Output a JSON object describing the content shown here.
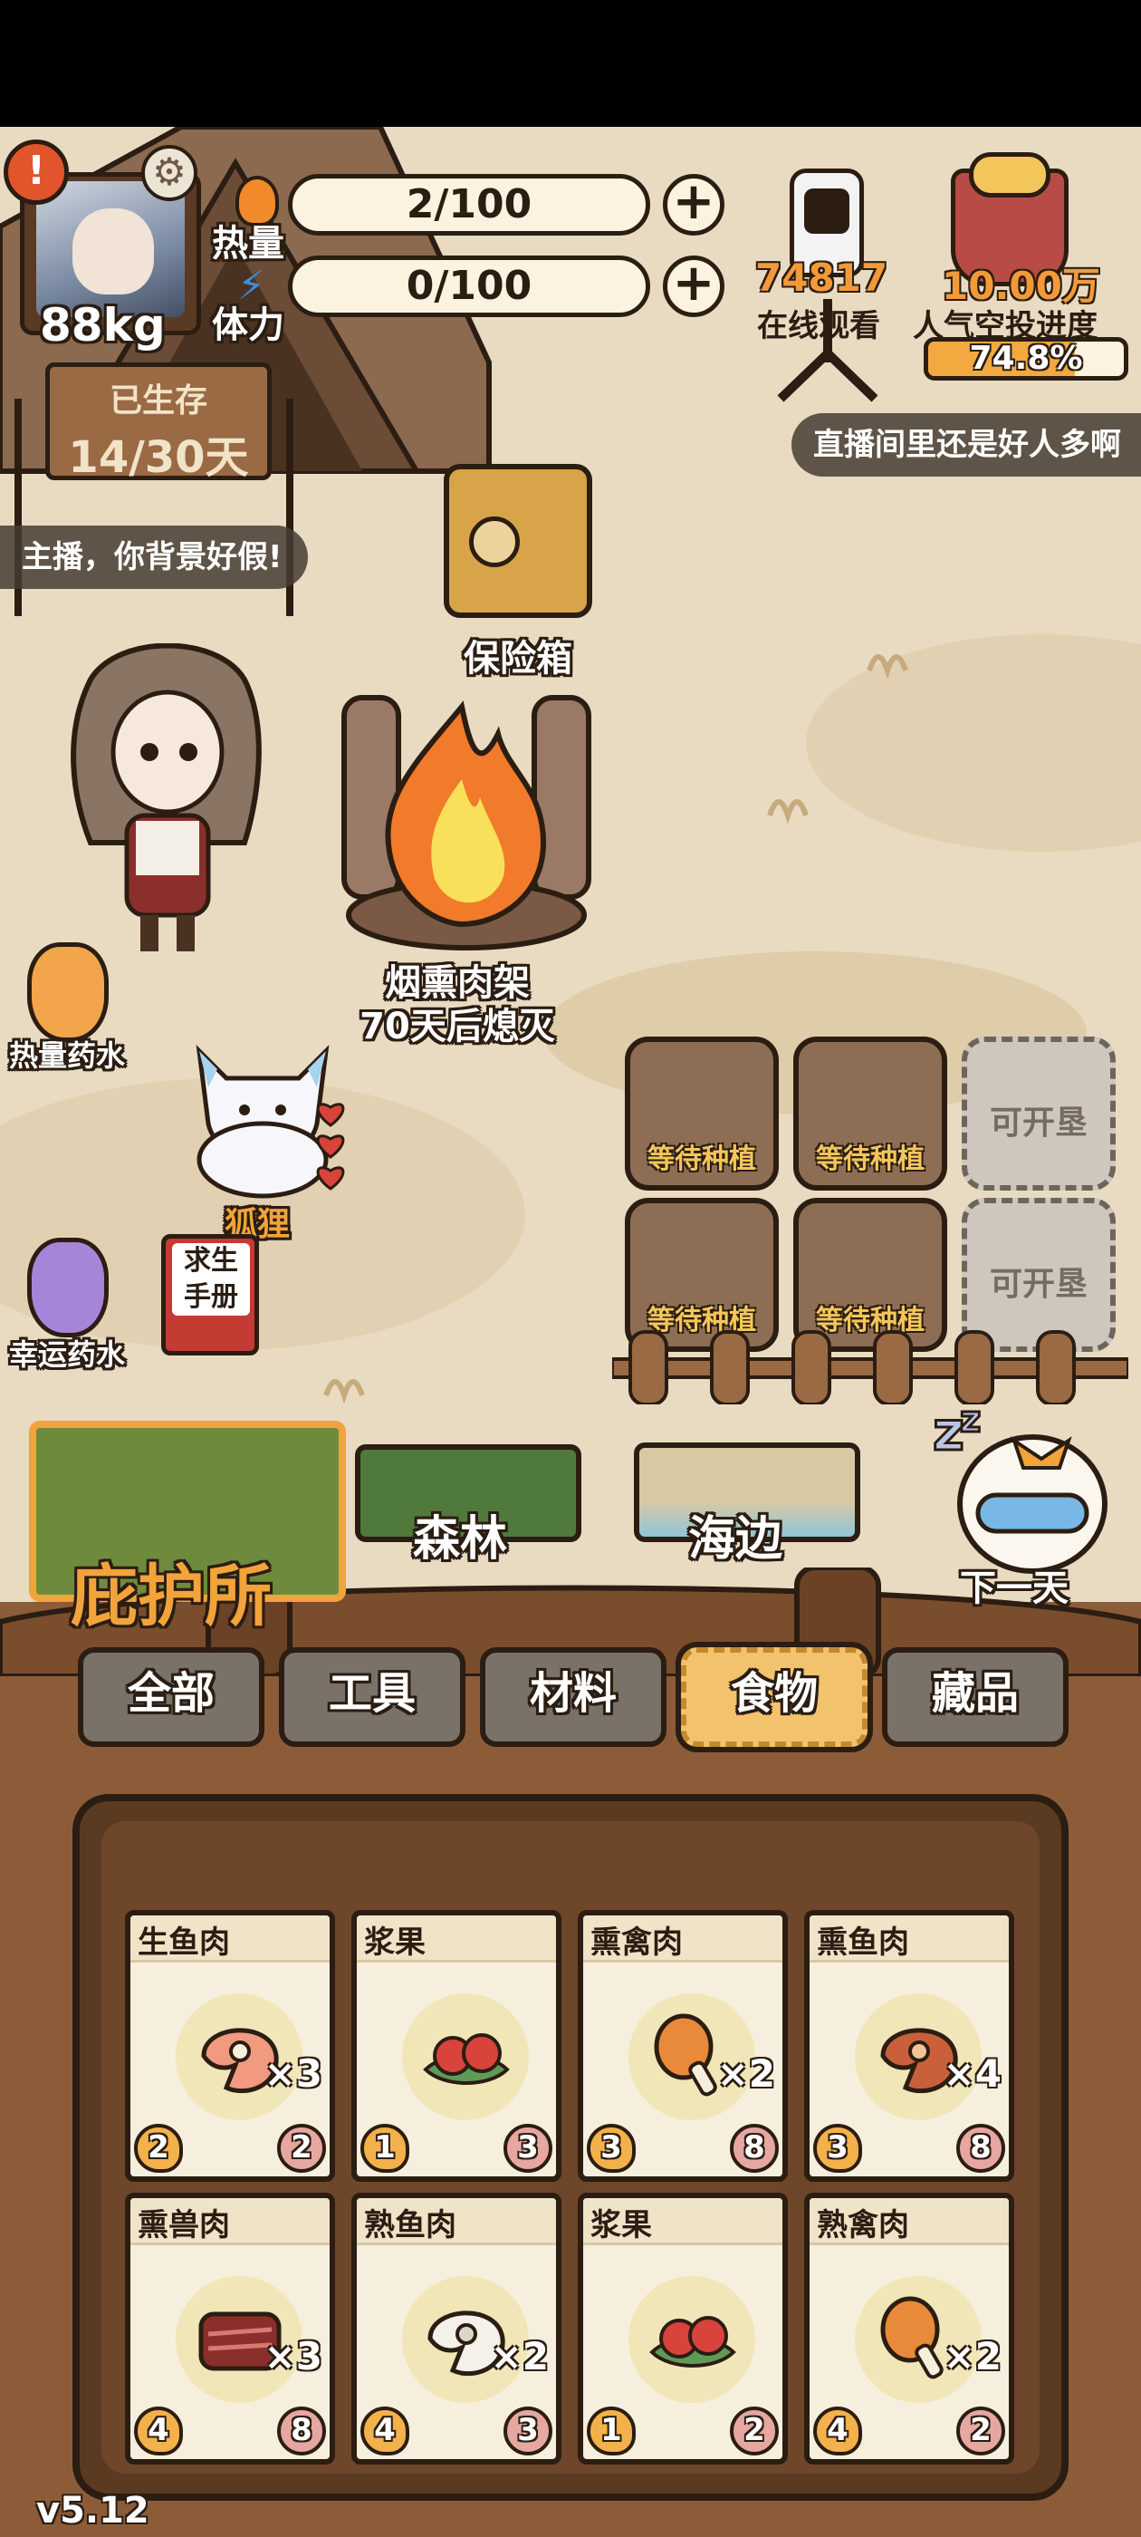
{
  "player": {
    "weight": "88kg",
    "stats": [
      {
        "label": "热量",
        "value": "2/100",
        "icon": "fire-icon"
      },
      {
        "label": "体力",
        "value": "0/100",
        "icon": "lightning-icon"
      }
    ],
    "survived": {
      "title": "已生存",
      "days": "14/30天"
    }
  },
  "stream": {
    "viewers": "74817",
    "viewers_label": "在线观看",
    "airdrop_value": "10.00万",
    "airdrop_label": "人气空投进度",
    "airdrop_progress_text": "74.8%",
    "airdrop_progress": 0.748,
    "bubble_right": "直播间里还是好人多啊",
    "bubble_left": "主播，你背景好假!"
  },
  "scene": {
    "safe_label": "保险箱",
    "fire_label_1": "烟熏肉架",
    "fire_label_2": "70天后熄灭",
    "potion_heat": "热量药水",
    "potion_luck": "幸运药水",
    "fox_label": "狐狸",
    "manual_label": "求生手册",
    "plots": [
      {
        "label": "等待种植",
        "state": "planted"
      },
      {
        "label": "等待种植",
        "state": "planted"
      },
      {
        "label": "可开垦",
        "state": "locked"
      },
      {
        "label": "等待种植",
        "state": "planted"
      },
      {
        "label": "等待种植",
        "state": "planted"
      },
      {
        "label": "可开垦",
        "state": "locked"
      }
    ]
  },
  "locations": {
    "shelter": "庇护所",
    "forest": "森林",
    "beach": "海边",
    "next_day": "下一天"
  },
  "inventory": {
    "tabs": [
      {
        "label": "全部",
        "active": false
      },
      {
        "label": "工具",
        "active": false
      },
      {
        "label": "材料",
        "active": false
      },
      {
        "label": "食物",
        "active": true
      },
      {
        "label": "藏品",
        "active": false
      }
    ],
    "items": [
      {
        "name": "生鱼肉",
        "qty": "×3",
        "calories": "2",
        "stamina": "2",
        "icon": "raw-fish-steak-icon"
      },
      {
        "name": "浆果",
        "qty": "",
        "calories": "1",
        "stamina": "3",
        "icon": "berries-icon"
      },
      {
        "name": "熏禽肉",
        "qty": "×2",
        "calories": "3",
        "stamina": "8",
        "icon": "drumstick-icon"
      },
      {
        "name": "熏鱼肉",
        "qty": "×4",
        "calories": "3",
        "stamina": "8",
        "icon": "smoked-fish-steak-icon"
      },
      {
        "name": "熏兽肉",
        "qty": "×3",
        "calories": "4",
        "stamina": "8",
        "icon": "smoked-meat-icon"
      },
      {
        "name": "熟鱼肉",
        "qty": "×2",
        "calories": "4",
        "stamina": "3",
        "icon": "cooked-fish-icon"
      },
      {
        "name": "浆果",
        "qty": "",
        "calories": "1",
        "stamina": "2",
        "icon": "berries-icon"
      },
      {
        "name": "熟禽肉",
        "qty": "×2",
        "calories": "4",
        "stamina": "2",
        "icon": "drumstick-icon"
      }
    ]
  },
  "version": "v5.12",
  "colors": {
    "accent_orange": "#f2a33a",
    "outline": "#2b1d12",
    "backpack_brown": "#8c5c38",
    "active_tab": "#f2c36c"
  }
}
